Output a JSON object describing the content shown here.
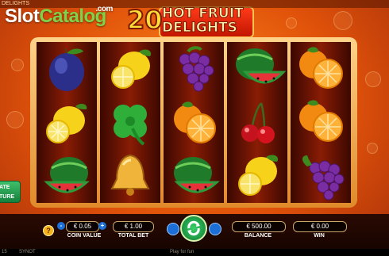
{
  "topbar": {
    "game_name": "DELIGHTS"
  },
  "watermark": {
    "part1": "Slot",
    "part2": "Catalog",
    "suffix": ".com"
  },
  "logo": {
    "number": "20",
    "line1": "HOT FRUIT",
    "line2": "DELIGHTS"
  },
  "side_button": {
    "line1": "ATE",
    "line2": "TURE"
  },
  "reels": [
    [
      "plum",
      "lemon",
      "watermelon"
    ],
    [
      "lemon",
      "clover",
      "bell"
    ],
    [
      "grapes",
      "orange",
      "watermelon"
    ],
    [
      "watermelon",
      "cherries",
      "lemon"
    ],
    [
      "orange",
      "orange",
      "grapes"
    ]
  ],
  "controls": {
    "info_icon": "info-icon",
    "coin_value": "€ 0.05",
    "coin_value_label": "COIN VALUE",
    "total_bet": "€ 1.00",
    "total_bet_label": "TOTAL BET",
    "balance": "€ 500.00",
    "balance_label": "BALANCE",
    "win": "€ 0.00",
    "win_label": "WIN",
    "minus": "-",
    "plus": "+"
  },
  "footer": {
    "left": "15",
    "brand": "SYNOT",
    "center": "Play for fun"
  },
  "colors": {
    "accent": "#1c6fd6",
    "spin": "#22a84a",
    "frame": "#e08a2a"
  }
}
